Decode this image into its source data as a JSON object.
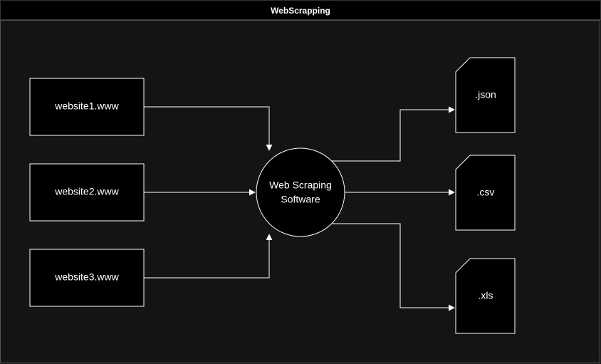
{
  "title": "WebScrapping",
  "inputs": {
    "site1": "website1.www",
    "site2": "website2.www",
    "site3": "website3.www"
  },
  "center": {
    "line1": "Web Scraping",
    "line2": "Software"
  },
  "outputs": {
    "json": ".json",
    "csv": ".csv",
    "xls": ".xls"
  }
}
